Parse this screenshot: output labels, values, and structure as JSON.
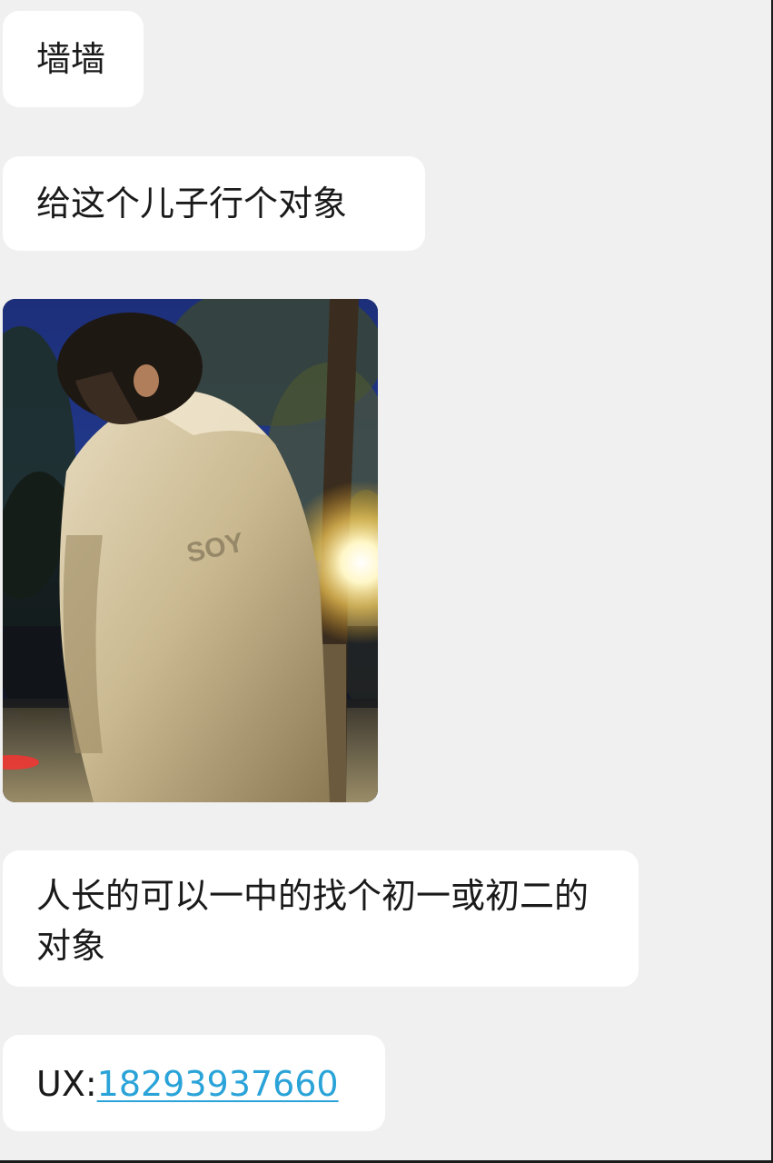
{
  "messages": {
    "m1": {
      "text": "墙墙"
    },
    "m2": {
      "text": "给这个儿子行个对象"
    },
    "m3": {
      "text": "人长的可以一中的找个初一或初二的对象"
    },
    "m4": {
      "prefix": "UX:",
      "phone": "18293937660"
    }
  },
  "photo": {
    "shirt_text": "SOY",
    "description_icon": "photo-boy-under-streetlight"
  },
  "colors": {
    "background": "#f0f0f0",
    "bubble": "#ffffff",
    "link": "#2aa3d8",
    "text": "#1a1a1a"
  }
}
